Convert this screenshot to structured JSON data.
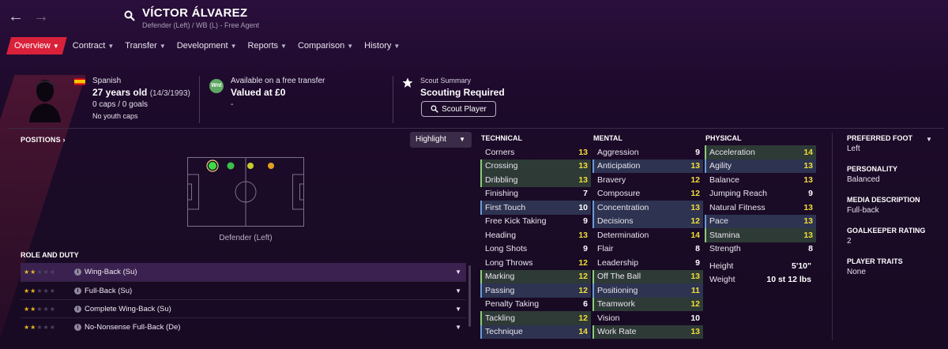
{
  "header": {
    "name": "VÍCTOR ÁLVAREZ",
    "subtitle": "Defender (Left) / WB (L) - Free Agent"
  },
  "tabs": [
    {
      "label": "Overview",
      "active": true
    },
    {
      "label": "Contract"
    },
    {
      "label": "Transfer"
    },
    {
      "label": "Development"
    },
    {
      "label": "Reports"
    },
    {
      "label": "Comparison"
    },
    {
      "label": "History"
    }
  ],
  "summary": {
    "nationality": "Spanish",
    "age": "27 years old",
    "dob": "(14/3/1993)",
    "caps": "0 caps / 0 goals",
    "youth": "No youth caps",
    "transfer_badge": "Wnt",
    "transfer_status": "Available on a free transfer",
    "valued": "Valued at £0",
    "transfer_extra": "-",
    "scout_title": "Scout Summary",
    "scout_status": "Scouting Required",
    "scout_button": "Scout Player"
  },
  "positions": {
    "title": "POSITIONS",
    "highlight_label": "Highlight",
    "pitch_label": "Defender (Left)",
    "dot_colors": [
      "#3ddc44",
      "#3bc04a",
      "#c8c92a",
      "#e0a020"
    ]
  },
  "roles": {
    "title": "ROLE AND DUTY",
    "items": [
      {
        "stars": 2,
        "name": "Wing-Back (Su)"
      },
      {
        "stars": 2,
        "name": "Full-Back (Su)"
      },
      {
        "stars": 2,
        "name": "Complete Wing-Back (Su)"
      },
      {
        "stars": 2,
        "name": "No-Nonsense Full-Back (De)"
      }
    ]
  },
  "technical": {
    "title": "TECHNICAL",
    "items": [
      {
        "name": "Corners",
        "value": "13",
        "hl": ""
      },
      {
        "name": "Crossing",
        "value": "13",
        "hl": "green"
      },
      {
        "name": "Dribbling",
        "value": "13",
        "hl": "green"
      },
      {
        "name": "Finishing",
        "value": "7",
        "hl": ""
      },
      {
        "name": "First Touch",
        "value": "10",
        "hl": "blue"
      },
      {
        "name": "Free Kick Taking",
        "value": "9",
        "hl": ""
      },
      {
        "name": "Heading",
        "value": "13",
        "hl": ""
      },
      {
        "name": "Long Shots",
        "value": "9",
        "hl": ""
      },
      {
        "name": "Long Throws",
        "value": "12",
        "hl": ""
      },
      {
        "name": "Marking",
        "value": "12",
        "hl": "green"
      },
      {
        "name": "Passing",
        "value": "12",
        "hl": "blue"
      },
      {
        "name": "Penalty Taking",
        "value": "6",
        "hl": ""
      },
      {
        "name": "Tackling",
        "value": "12",
        "hl": "green"
      },
      {
        "name": "Technique",
        "value": "14",
        "hl": "blue"
      }
    ]
  },
  "mental": {
    "title": "MENTAL",
    "items": [
      {
        "name": "Aggression",
        "value": "9",
        "hl": ""
      },
      {
        "name": "Anticipation",
        "value": "13",
        "hl": "blue"
      },
      {
        "name": "Bravery",
        "value": "12",
        "hl": ""
      },
      {
        "name": "Composure",
        "value": "12",
        "hl": ""
      },
      {
        "name": "Concentration",
        "value": "13",
        "hl": "blue"
      },
      {
        "name": "Decisions",
        "value": "12",
        "hl": "blue"
      },
      {
        "name": "Determination",
        "value": "14",
        "hl": ""
      },
      {
        "name": "Flair",
        "value": "8",
        "hl": ""
      },
      {
        "name": "Leadership",
        "value": "9",
        "hl": ""
      },
      {
        "name": "Off The Ball",
        "value": "13",
        "hl": "green"
      },
      {
        "name": "Positioning",
        "value": "11",
        "hl": "blue"
      },
      {
        "name": "Teamwork",
        "value": "12",
        "hl": "green"
      },
      {
        "name": "Vision",
        "value": "10",
        "hl": ""
      },
      {
        "name": "Work Rate",
        "value": "13",
        "hl": "green"
      }
    ]
  },
  "physical": {
    "title": "PHYSICAL",
    "items": [
      {
        "name": "Acceleration",
        "value": "14",
        "hl": "green"
      },
      {
        "name": "Agility",
        "value": "13",
        "hl": "blue"
      },
      {
        "name": "Balance",
        "value": "13",
        "hl": ""
      },
      {
        "name": "Jumping Reach",
        "value": "9",
        "hl": ""
      },
      {
        "name": "Natural Fitness",
        "value": "13",
        "hl": ""
      },
      {
        "name": "Pace",
        "value": "13",
        "hl": "blue"
      },
      {
        "name": "Stamina",
        "value": "13",
        "hl": "green"
      },
      {
        "name": "Strength",
        "value": "8",
        "hl": ""
      }
    ],
    "height_label": "Height",
    "height": "5'10\"",
    "weight_label": "Weight",
    "weight": "10 st 12 lbs"
  },
  "info": {
    "preferred_foot_label": "PREFERRED FOOT",
    "preferred_foot": "Left",
    "personality_label": "PERSONALITY",
    "personality": "Balanced",
    "media_label": "MEDIA DESCRIPTION",
    "media": "Full-back",
    "gk_label": "GOALKEEPER RATING",
    "gk": "2",
    "traits_label": "PLAYER TRAITS",
    "traits": "None"
  }
}
